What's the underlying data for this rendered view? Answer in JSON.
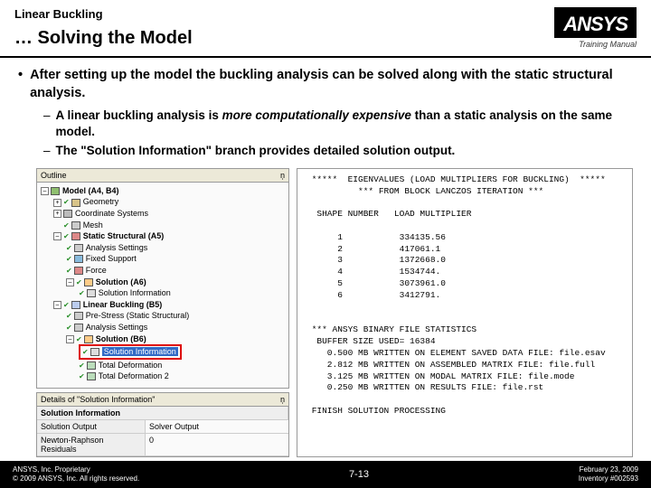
{
  "header": {
    "topic": "Linear Buckling",
    "title": "… Solving the Model",
    "logo": "ANSYS",
    "training": "Training Manual"
  },
  "bullets": {
    "main": "After setting up the model the buckling analysis can be solved along with the static structural analysis.",
    "sub1a": "A linear buckling analysis is ",
    "sub1em": "more computationally expensive",
    "sub1b": " than a static analysis on the same model.",
    "sub2": "The \"Solution Information\" branch provides detailed solution output."
  },
  "outline": {
    "title": "Outline",
    "model": "Model (A4, B4)",
    "geometry": "Geometry",
    "coord": "Coordinate Systems",
    "mesh": "Mesh",
    "static": "Static Structural (A5)",
    "anset1": "Analysis Settings",
    "fixed": "Fixed Support",
    "force": "Force",
    "solA": "Solution (A6)",
    "solinfoA": "Solution Information",
    "linbuck": "Linear Buckling (B5)",
    "prestress": "Pre-Stress (Static Structural)",
    "anset2": "Analysis Settings",
    "solB": "Solution (B6)",
    "solinfoB": "Solution Information",
    "td1": "Total Deformation",
    "td2": "Total Deformation 2"
  },
  "details": {
    "title": "Details of \"Solution Information\"",
    "header": "Solution Information",
    "row1l": "Solution Output",
    "row1v": "Solver Output",
    "row2l": "Newton-Raphson Residuals",
    "row2v": "0"
  },
  "output": {
    "l1": " *****  EIGENVALUES (LOAD MULTIPLIERS FOR BUCKLING)  *****",
    "l2": "          *** FROM BLOCK LANCZOS ITERATION ***",
    "l3": "",
    "l4": "  SHAPE NUMBER   LOAD MULTIPLIER",
    "l5": "",
    "l6": "      1           334135.56",
    "l7": "      2           417061.1",
    "l8": "      3           1372668.0",
    "l9": "      4           1534744.",
    "l10": "      5           3073961.0",
    "l11": "      6           3412791.",
    "l12": "",
    "l13": "",
    "l14": " *** ANSYS BINARY FILE STATISTICS",
    "l15": "  BUFFER SIZE USED= 16384",
    "l16": "    0.500 MB WRITTEN ON ELEMENT SAVED DATA FILE: file.esav",
    "l17": "    2.812 MB WRITTEN ON ASSEMBLED MATRIX FILE: file.full",
    "l18": "    3.125 MB WRITTEN ON MODAL MATRIX FILE: file.mode",
    "l19": "    0.250 MB WRITTEN ON RESULTS FILE: file.rst",
    "l20": "",
    "l21": " FINISH SOLUTION PROCESSING"
  },
  "footer": {
    "prop1": "ANSYS, Inc. Proprietary",
    "prop2": "© 2009 ANSYS, Inc. All rights reserved.",
    "page": "7-13",
    "date": "February 23, 2009",
    "inv": "Inventory #002593"
  }
}
